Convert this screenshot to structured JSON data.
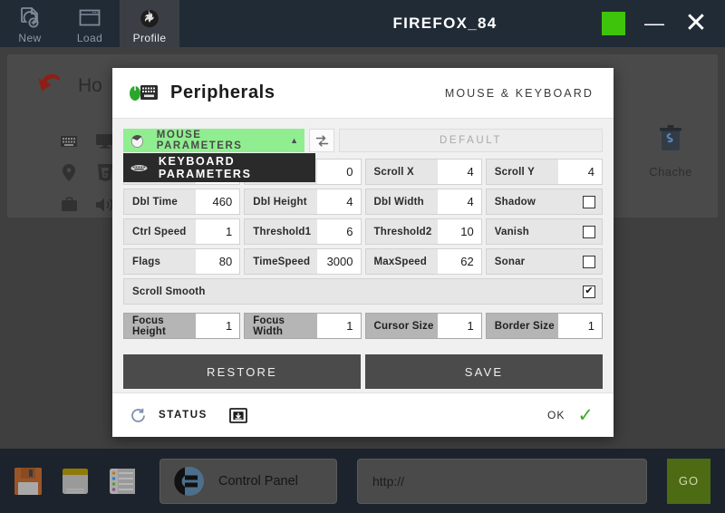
{
  "titlebar": {
    "tabs": [
      {
        "label": "New",
        "icon": "new-document-icon"
      },
      {
        "label": "Load",
        "icon": "window-load-icon"
      },
      {
        "label": "Profile",
        "icon": "firefox-profile-icon"
      }
    ],
    "title": "FIREFOX_84",
    "green_indicator_color": "#3fc40c",
    "minimize_label": "—",
    "close_label": "✕"
  },
  "desktop": {
    "home_label": "Ho",
    "back_icon": "red-curved-arrow-icon",
    "icons": [
      "keyboard-icon",
      "monitor-icon",
      "location-pin-icon",
      "html5-icon",
      "briefcase-icon",
      "speaker-icon"
    ],
    "chache_label": "Chache",
    "chache_icon": "trash-bin-icon"
  },
  "dialog": {
    "icon": "mouse-keyboard-icon",
    "title": "Peripherals",
    "subtitle": "MOUSE & KEYBOARD",
    "selector": {
      "selected": "MOUSE PARAMETERS",
      "selected_color": "#90ee90",
      "caret": "▲",
      "swap_icon": "swap-arrows-icon",
      "default_label": "DEFAULT",
      "dropdown_open": true,
      "options": [
        {
          "label": "MOUSE PARAMETERS",
          "icon": "mouse-icon"
        },
        {
          "label": "KEYBOARD PARAMETERS",
          "icon": "keyboard-icon"
        }
      ],
      "dropdown_item": {
        "label": "KEYBOARD PARAMETERS",
        "icon": "keyboard-icon"
      }
    },
    "params": {
      "rows": [
        [
          {
            "name": "hidden-param-1",
            "label": "",
            "value": "",
            "type": "number",
            "hidden": true
          },
          {
            "name": "hidden-param-2",
            "label": "",
            "value": "0",
            "type": "number",
            "hidden": true
          },
          {
            "name": "scroll-x",
            "label": "Scroll X",
            "value": "4",
            "type": "number"
          },
          {
            "name": "scroll-y",
            "label": "Scroll Y",
            "value": "4",
            "type": "number"
          }
        ],
        [
          {
            "name": "dbl-time",
            "label": "Dbl Time",
            "value": "460",
            "type": "number"
          },
          {
            "name": "dbl-height",
            "label": "Dbl Height",
            "value": "4",
            "type": "number"
          },
          {
            "name": "dbl-width",
            "label": "Dbl Width",
            "value": "4",
            "type": "number"
          },
          {
            "name": "shadow",
            "label": "Shadow",
            "value": "",
            "checked": false,
            "type": "checkbox"
          }
        ],
        [
          {
            "name": "ctrl-speed",
            "label": "Ctrl Speed",
            "value": "1",
            "type": "number"
          },
          {
            "name": "threshold1",
            "label": "Threshold1",
            "value": "6",
            "type": "number"
          },
          {
            "name": "threshold2",
            "label": "Threshold2",
            "value": "10",
            "type": "number"
          },
          {
            "name": "vanish",
            "label": "Vanish",
            "value": "",
            "checked": false,
            "type": "checkbox"
          }
        ],
        [
          {
            "name": "flags",
            "label": "Flags",
            "value": "80",
            "type": "number"
          },
          {
            "name": "time-speed",
            "label": "TimeSpeed",
            "value": "3000",
            "type": "number"
          },
          {
            "name": "max-speed",
            "label": "MaxSpeed",
            "value": "62",
            "type": "number"
          },
          {
            "name": "sonar",
            "label": "Sonar",
            "value": "",
            "checked": false,
            "type": "checkbox"
          }
        ]
      ],
      "scroll_smooth": {
        "label": "Scroll Smooth",
        "checked": true,
        "check_glyph": "✔"
      },
      "focus_row": [
        {
          "name": "focus-height",
          "label": "Focus Height",
          "value": "1"
        },
        {
          "name": "focus-width",
          "label": "Focus Width",
          "value": "1"
        },
        {
          "name": "cursor-size",
          "label": "Cursor Size",
          "value": "1"
        },
        {
          "name": "border-size",
          "label": "Border Size",
          "value": "1"
        }
      ]
    },
    "actions": {
      "restore": "RESTORE",
      "save": "SAVE"
    },
    "footer": {
      "refresh_icon": "refresh-icon",
      "status_label": "STATUS",
      "download_icon": "download-folder-icon",
      "ok_label": "OK",
      "ok_check": "✓",
      "ok_color": "#3fa82a"
    }
  },
  "taskbar": {
    "tray": [
      {
        "name": "floppy-save-icon"
      },
      {
        "name": "notepad-icon"
      },
      {
        "name": "list-icon"
      }
    ],
    "control_panel": {
      "label": "Control Panel",
      "icon": "control-panel-icon"
    },
    "url_value": "http://",
    "go_label": "GO",
    "go_color": "#4c6b12"
  }
}
